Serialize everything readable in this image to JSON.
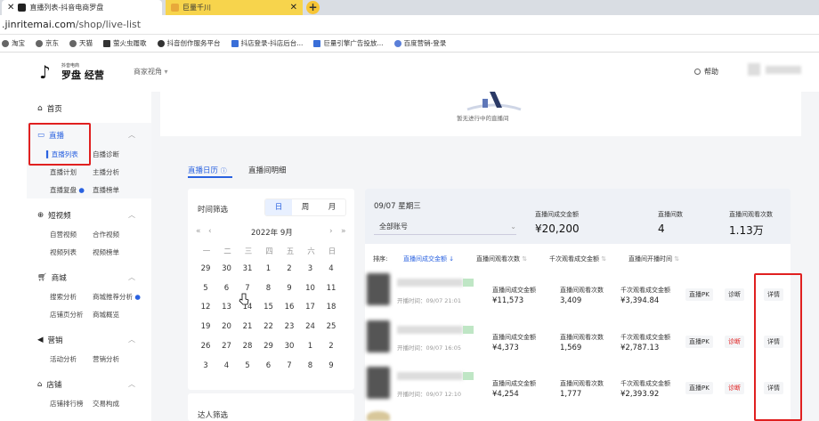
{
  "browser": {
    "tabs": [
      {
        "title": "直播列表-抖音电商罗盘"
      },
      {
        "title": "巨量千川"
      }
    ],
    "url_host": ".jinritemai.com",
    "url_path": "/shop/live-list",
    "bookmarks": [
      "淘宝",
      "京东",
      "天猫",
      "萤火虫履歌",
      "抖音创作服务平台",
      "抖店登录-抖店后台...",
      "巨量引擎广告投放...",
      "百度营销-登录"
    ]
  },
  "header": {
    "brand_small": "抖音电商",
    "brand": "罗盘 经营",
    "merchant_view": "商家视角",
    "help": "帮助"
  },
  "sidebar": {
    "home": "首页",
    "live": {
      "title": "直播",
      "items": [
        "直播列表",
        "自播诊断",
        "直播计划",
        "主播分析",
        "直播复盘",
        "直播榜单"
      ]
    },
    "short_video": {
      "title": "短视频",
      "items": [
        "自营视频",
        "合作视频",
        "视频列表",
        "视频榜单"
      ]
    },
    "mall": {
      "title": "商城",
      "items": [
        "搜索分析",
        "商城推荐分析",
        "店铺页分析",
        "商城概览"
      ]
    },
    "marketing": {
      "title": "营销",
      "items": [
        "活动分析",
        "营销分析"
      ]
    },
    "store": {
      "title": "店铺",
      "items": [
        "店铺排行榜",
        "交易构成"
      ]
    }
  },
  "main": {
    "empty_text": "暂无进行中的直播间",
    "tabs": [
      "直播日历",
      "直播间明细"
    ],
    "time_filter": "时间筛选",
    "seg": [
      "日",
      "周",
      "月"
    ],
    "month": "2022年 9月",
    "week_head": [
      "一",
      "二",
      "三",
      "四",
      "五",
      "六",
      "日"
    ],
    "weeks": [
      [
        "29",
        "30",
        "31",
        "1",
        "2",
        "3",
        "4"
      ],
      [
        "5",
        "6",
        "7",
        "8",
        "9",
        "10",
        "11"
      ],
      [
        "12",
        "13",
        "14",
        "15",
        "16",
        "17",
        "18"
      ],
      [
        "19",
        "20",
        "21",
        "22",
        "23",
        "24",
        "25"
      ],
      [
        "26",
        "27",
        "28",
        "29",
        "30",
        "1",
        "2"
      ],
      [
        "3",
        "4",
        "5",
        "6",
        "7",
        "8",
        "9"
      ]
    ],
    "talent_filter": "达人筛选",
    "summary": {
      "date": "09/07 星期三",
      "account": "全部账号",
      "gmv_label": "直播间成交金额",
      "gmv": "¥20,200",
      "count_label": "直播间数",
      "count": "4",
      "views_label": "直播间观看次数",
      "views": "1.13万"
    },
    "sort_label": "排序:",
    "sort_options": [
      "直播间成交金额",
      "直播间观看次数",
      "千次观看成交金额",
      "直播间开播时间"
    ],
    "rows": [
      {
        "time": "开播时间：09/07 21:01",
        "gmv_label": "直播间成交金额",
        "gmv": "¥11,573",
        "views_label": "直播间观看次数",
        "views": "3,409",
        "gpm_label": "千次观看成交金额",
        "gpm": "¥3,394.84",
        "pk": "直播PK",
        "diag": "诊断",
        "detail": "详情"
      },
      {
        "time": "开播时间：09/07 16:05",
        "gmv_label": "直播间成交金额",
        "gmv": "¥4,373",
        "views_label": "直播间观看次数",
        "views": "1,569",
        "gpm_label": "千次观看成交金额",
        "gpm": "¥2,787.13",
        "pk": "直播PK",
        "diag": "诊断",
        "detail": "详情"
      },
      {
        "time": "开播时间：09/07 12:10",
        "gmv_label": "直播间成交金额",
        "gmv": "¥4,254",
        "views_label": "直播间观看次数",
        "views": "1,777",
        "gpm_label": "千次观看成交金额",
        "gpm": "¥2,393.92",
        "pk": "直播PK",
        "diag": "诊断",
        "detail": "详情"
      }
    ]
  },
  "colors": {
    "accent": "#2a62e0",
    "highlight": "#e02020"
  }
}
